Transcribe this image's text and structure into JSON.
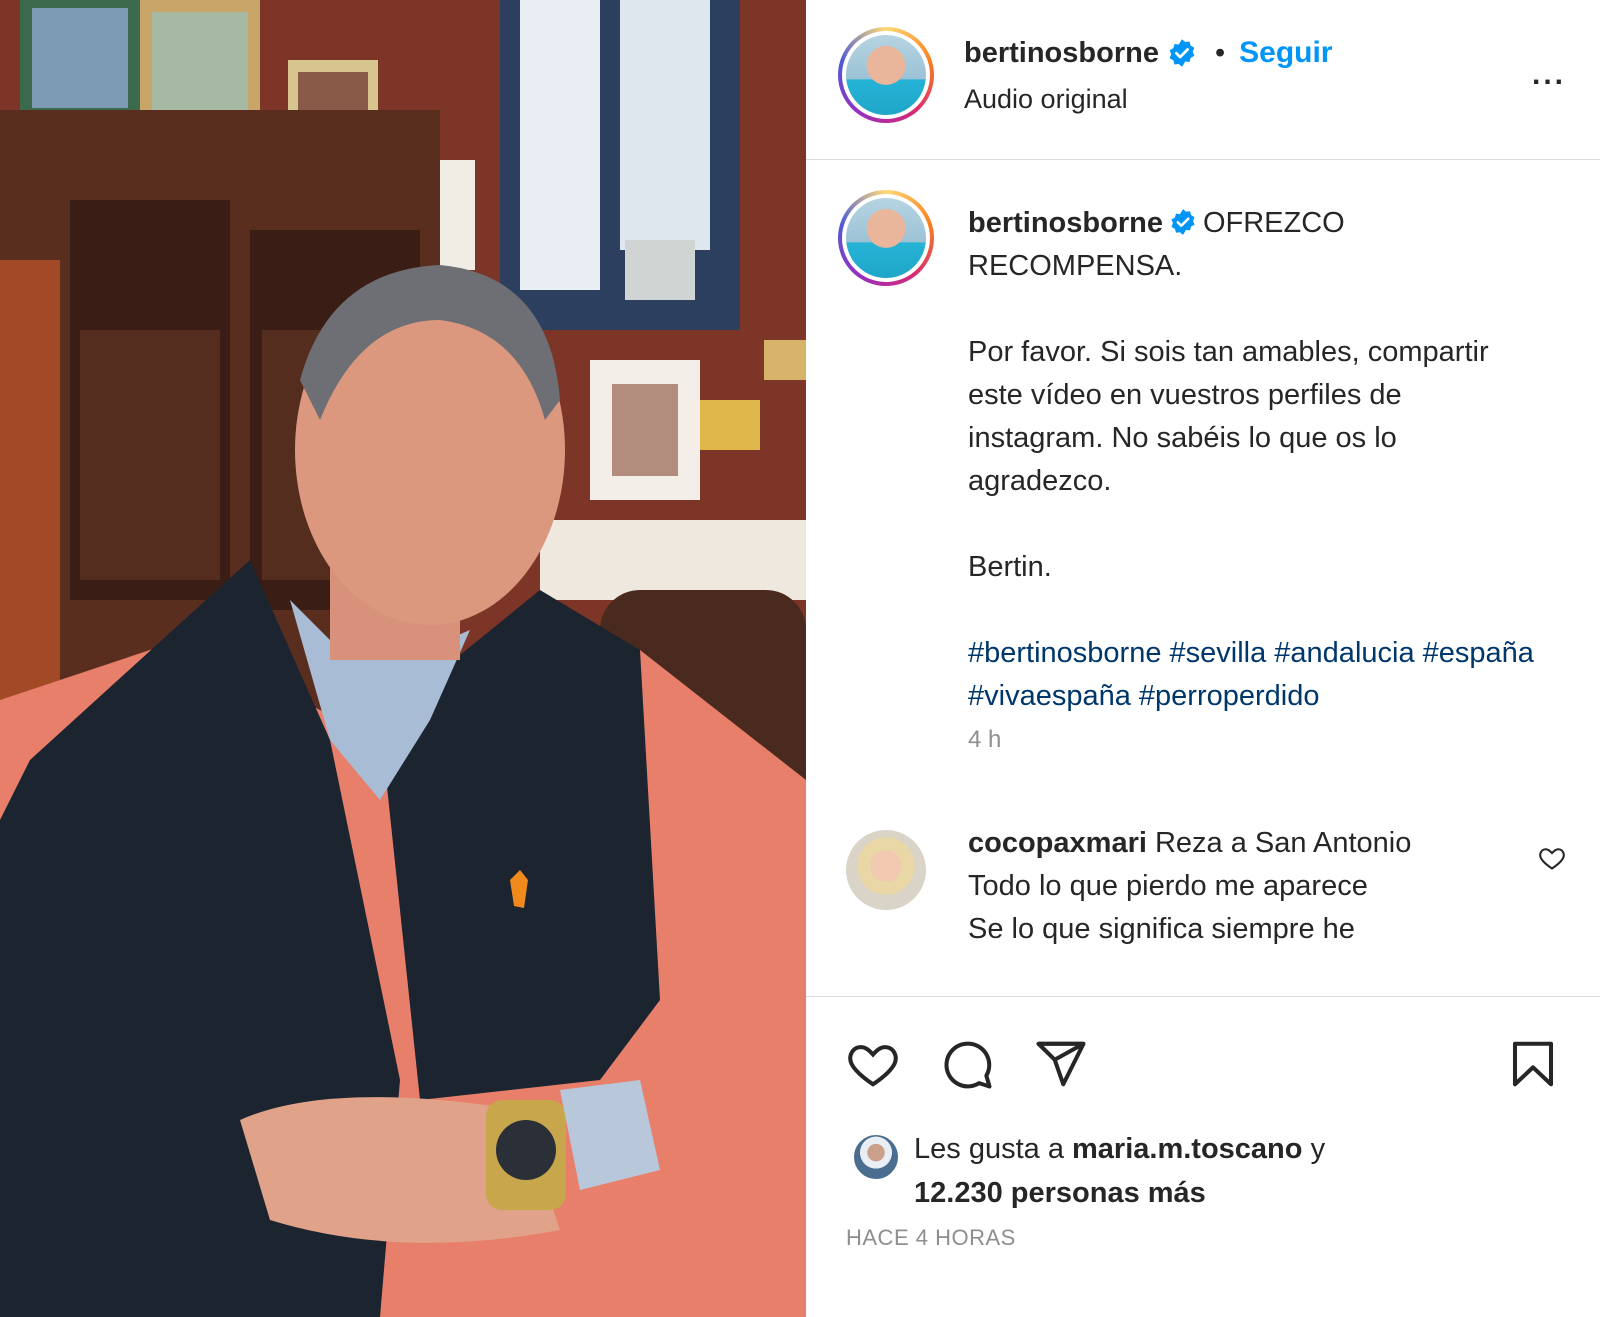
{
  "post": {
    "username": "bertinosborne",
    "separator": "•",
    "follow_label": "Seguir",
    "audio_label": "Audio original",
    "more_label": "...",
    "verified_icon": "verified-badge-icon"
  },
  "caption": {
    "username": "bertinosborne",
    "line1": "OFREZCO RECOMPENSA.",
    "paragraph": "Por favor. Si sois tan amables, compartir este vídeo en vuestros perfiles de instagram. No sabéis lo que os lo agradezco.",
    "signature": "Bertin.",
    "hashtags": "#bertinosborne #sevilla #andalucia #españa #vivaespaña #perroperdido",
    "time": "4 h"
  },
  "comment": {
    "username": "cocopaxmari",
    "text_line1": "Reza a San Antonio",
    "text_line2": "Todo lo que pierdo me aparece",
    "text_line3": "Se lo que significa siempre he"
  },
  "actions": {
    "icons": [
      "heart-icon",
      "comment-icon",
      "share-icon",
      "bookmark-icon"
    ],
    "likes_prefix": "Les gusta a",
    "likes_user": "maria.m.toscano",
    "likes_and": "y",
    "likes_count": "12.230 personas más",
    "ago": "HACE 4 HORAS"
  },
  "colors": {
    "accent": "#0095f6",
    "hashtag": "#00376b",
    "muted": "#8e8e8e",
    "border": "#dbdbdb"
  }
}
